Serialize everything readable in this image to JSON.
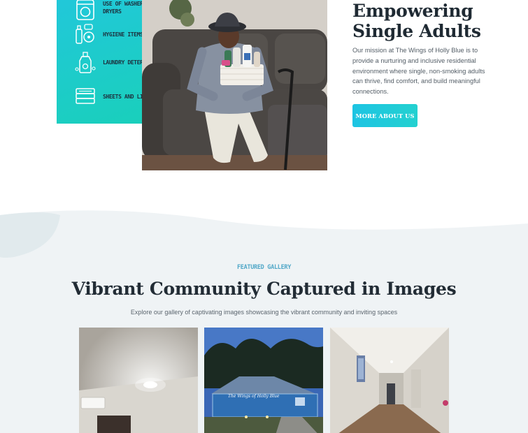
{
  "amenities": [
    {
      "label": "Use of washers and dryers",
      "icon": "washing-machine-icon"
    },
    {
      "label": "Hygiene items",
      "icon": "hygiene-items-icon"
    },
    {
      "label": "Laundry detergent",
      "icon": "detergent-bottle-icon"
    },
    {
      "label": "Sheets and linens",
      "icon": "folded-linens-icon"
    }
  ],
  "hero": {
    "title_line1": "Empowering",
    "title_line2": "Single Adults",
    "description": "Our mission at The Wings of Holly Blue is to provide a nurturing and inclusive residential environment where single, non-smoking adults can thrive, find comfort, and build meaningful connections.",
    "button_label": "More about us"
  },
  "gallery": {
    "eyebrow": "Featured Gallery",
    "title": "Vibrant Community Captured in Images",
    "subtitle": "Explore our gallery of captivating images showcasing the vibrant community and inviting spaces",
    "house_sign": "The Wings of Holly Blue"
  },
  "colors": {
    "accent_gradient_start": "#22c7dc",
    "accent_gradient_end": "#19d0b9",
    "eyebrow": "#52a8c8",
    "section_bg": "#eff3f5"
  }
}
